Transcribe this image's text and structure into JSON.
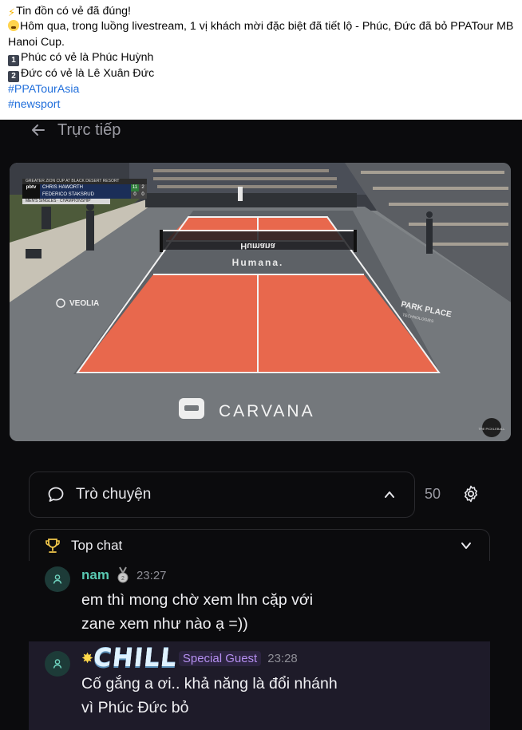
{
  "post": {
    "line1": "Tin đồn có vẻ đã đúng!",
    "line2": "Hôm qua, trong luồng livestream, 1 vị khách mời đặc biệt đã tiết lộ - Phúc, Đức đã bỏ PPATour MB Hanoi Cup.",
    "item1_key": "1",
    "item1": "Phúc có vẻ là Phúc Huỳnh",
    "item2_key": "2",
    "item2": "Đức có vẻ là Lê Xuân Đức",
    "hashtag1": "#PPATourAsia",
    "hashtag2": "#newsport"
  },
  "app": {
    "header_title": "Trực tiếp",
    "video": {
      "scorebug_banner": "GREATER ZION CUP AT BLACK DESERT RESORT",
      "logo": "pbtv",
      "player1": "CHRIS HAWORTH",
      "player1_score": "11",
      "player1_game": "2",
      "player2": "FEDERICO STAKSRUD",
      "player2_score": "0",
      "player2_game": "0",
      "event": "MEN'S SINGLES · CHAMPIONSHIP",
      "sponsor_net": "Humana",
      "sponsor_court": "Humana.",
      "sponsor_left": "VEOLIA",
      "sponsor_right": "PARK PLACE",
      "sponsor_right_sub": "TECHNOLOGIES",
      "sponsor_bottom": "CARVANA",
      "corner_badge": "THE PICKLEBALL"
    },
    "chat": {
      "title": "Trò chuyện",
      "count": "50",
      "topchat_label": "Top chat",
      "messages": [
        {
          "name": "nam",
          "time": "23:27",
          "line1": "em thì mong chờ xem lhn cặp với",
          "line2": "zane xem như nào ạ =))"
        },
        {
          "badge_text": "CHILL",
          "role": "Special Guest",
          "time": "23:28",
          "line1": "Cố gắng a ơi.. khả năng là đổi nhánh",
          "line2": "vì Phúc Đức bỏ"
        }
      ]
    },
    "colors": {
      "background": "#0b0b0d",
      "username": "#58c7b1",
      "special_guest": "#b58ff0",
      "court_orange": "#e8684d",
      "court_gray": "#5d6166"
    }
  }
}
